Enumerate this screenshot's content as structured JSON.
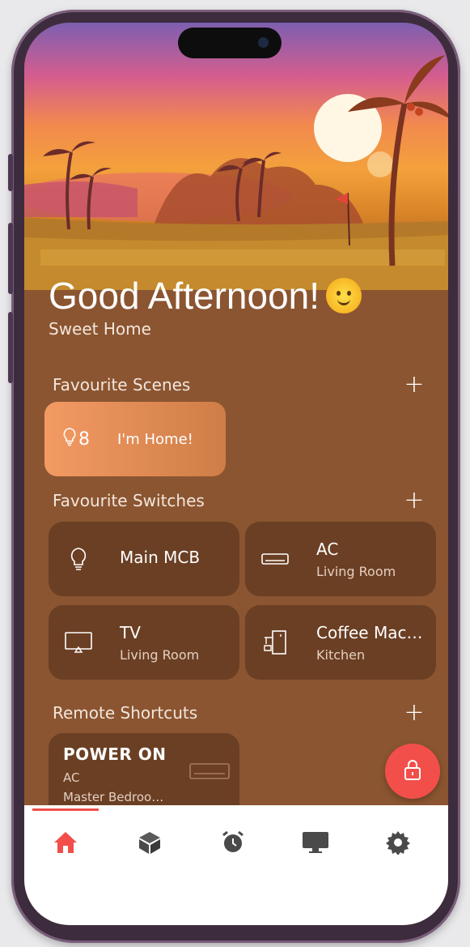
{
  "greeting": "Good Afternoon!",
  "greeting_emoji": "sun-with-face",
  "home_name": "Sweet Home",
  "sections": {
    "scenes": "Favourite Scenes",
    "switches": "Favourite Switches",
    "remotes": "Remote Shortcuts"
  },
  "add_label": "+",
  "scene": {
    "icon": "bulb-icon",
    "count": "8",
    "label": "I'm Home!"
  },
  "switches": [
    {
      "icon": "bulb-icon",
      "name": "Main MCB",
      "room": ""
    },
    {
      "icon": "ac-icon",
      "name": "AC",
      "room": "Living Room"
    },
    {
      "icon": "tv-icon",
      "name": "TV",
      "room": "Living Room"
    },
    {
      "icon": "coffee-machine-icon",
      "name": "Coffee Mac…",
      "room": "Kitchen"
    }
  ],
  "remote": {
    "title": "POWER ON",
    "device": "AC",
    "room": "Master Bedroo…",
    "icon": "ac-icon"
  },
  "nav": [
    "home-icon",
    "cube-icon",
    "alarm-icon",
    "monitor-icon",
    "gear-icon"
  ],
  "colors": {
    "accent": "#f24f4a",
    "background": "#8b5531",
    "card": "#6b3f24",
    "scene_card": "#f39a63"
  }
}
